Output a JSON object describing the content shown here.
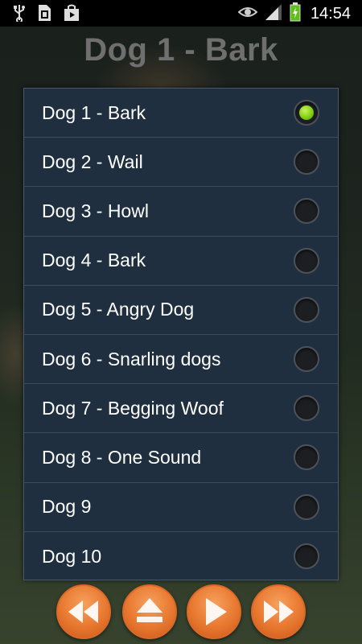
{
  "status_bar": {
    "time": "14:54",
    "icons": [
      "usb-icon",
      "sd-card-icon",
      "play-store-icon",
      "eye-icon",
      "signal-icon",
      "battery-charging-icon"
    ]
  },
  "screen_title": "Dog 1 - Bark",
  "sound_list": {
    "items": [
      {
        "label": "Dog 1 - Bark",
        "selected": true
      },
      {
        "label": "Dog 2 - Wail",
        "selected": false
      },
      {
        "label": "Dog 3 - Howl",
        "selected": false
      },
      {
        "label": "Dog 4 - Bark",
        "selected": false
      },
      {
        "label": "Dog 5 - Angry Dog",
        "selected": false
      },
      {
        "label": "Dog 6 - Snarling dogs",
        "selected": false
      },
      {
        "label": "Dog 7 - Begging Woof",
        "selected": false
      },
      {
        "label": "Dog 8 - One Sound",
        "selected": false
      },
      {
        "label": "Dog 9",
        "selected": false
      },
      {
        "label": "Dog 10",
        "selected": false
      }
    ]
  },
  "controls": {
    "buttons": [
      "rewind-icon",
      "eject-icon",
      "play-icon",
      "fast-forward-icon"
    ]
  },
  "colors": {
    "accent_orange": "#e8772f",
    "radio_selected": "#7ccc10",
    "dialog_bg": "#1f2f40"
  }
}
